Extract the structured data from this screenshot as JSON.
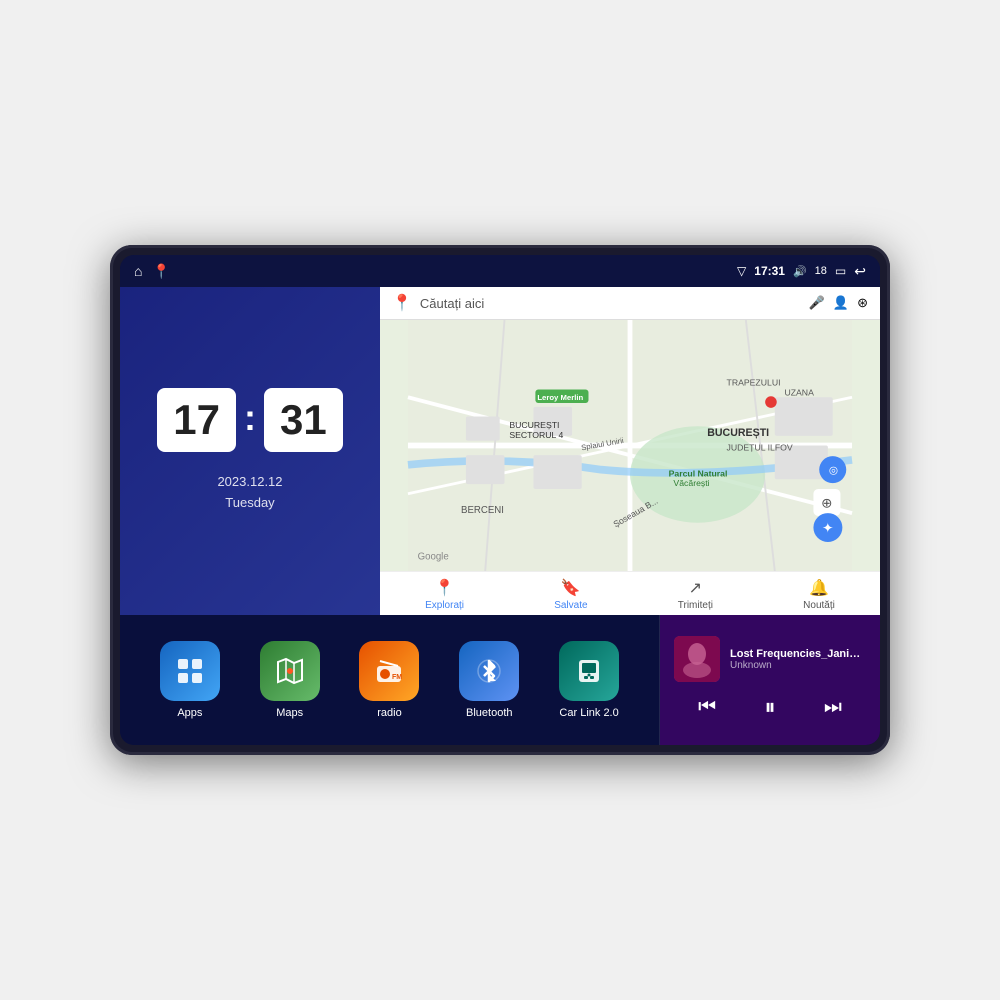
{
  "device": {
    "status_bar": {
      "left_icons": [
        "home",
        "map-pin"
      ],
      "time": "17:31",
      "volume_icon": "🔊",
      "battery_level": "18",
      "battery_icon": "🔋",
      "back_icon": "↩"
    },
    "clock": {
      "hours": "17",
      "minutes": "31",
      "date": "2023.12.12",
      "day": "Tuesday"
    },
    "map": {
      "search_placeholder": "Căutați aici",
      "nav_items": [
        {
          "label": "Explorați",
          "icon": "📍"
        },
        {
          "label": "Salvate",
          "icon": "🔖"
        },
        {
          "label": "Trimiteți",
          "icon": "↗"
        },
        {
          "label": "Noutăți",
          "icon": "🔔"
        }
      ],
      "location_label": "BUCUREȘTI",
      "sublabel": "JUDEȚUL ILFOV"
    },
    "apps": [
      {
        "id": "apps",
        "label": "Apps",
        "bg_class": "apps-bg",
        "icon": "⊞"
      },
      {
        "id": "maps",
        "label": "Maps",
        "bg_class": "maps-bg",
        "icon": "🗺"
      },
      {
        "id": "radio",
        "label": "radio",
        "bg_class": "radio-bg",
        "icon": "📻"
      },
      {
        "id": "bluetooth",
        "label": "Bluetooth",
        "bg_class": "bluetooth-bg",
        "icon": "🔷"
      },
      {
        "id": "carlink",
        "label": "Car Link 2.0",
        "bg_class": "carlink-bg",
        "icon": "📱"
      }
    ],
    "music": {
      "title": "Lost Frequencies_Janieck Devy-...",
      "artist": "Unknown",
      "controls": {
        "prev": "⏮",
        "play_pause": "⏸",
        "next": "⏭"
      }
    }
  }
}
